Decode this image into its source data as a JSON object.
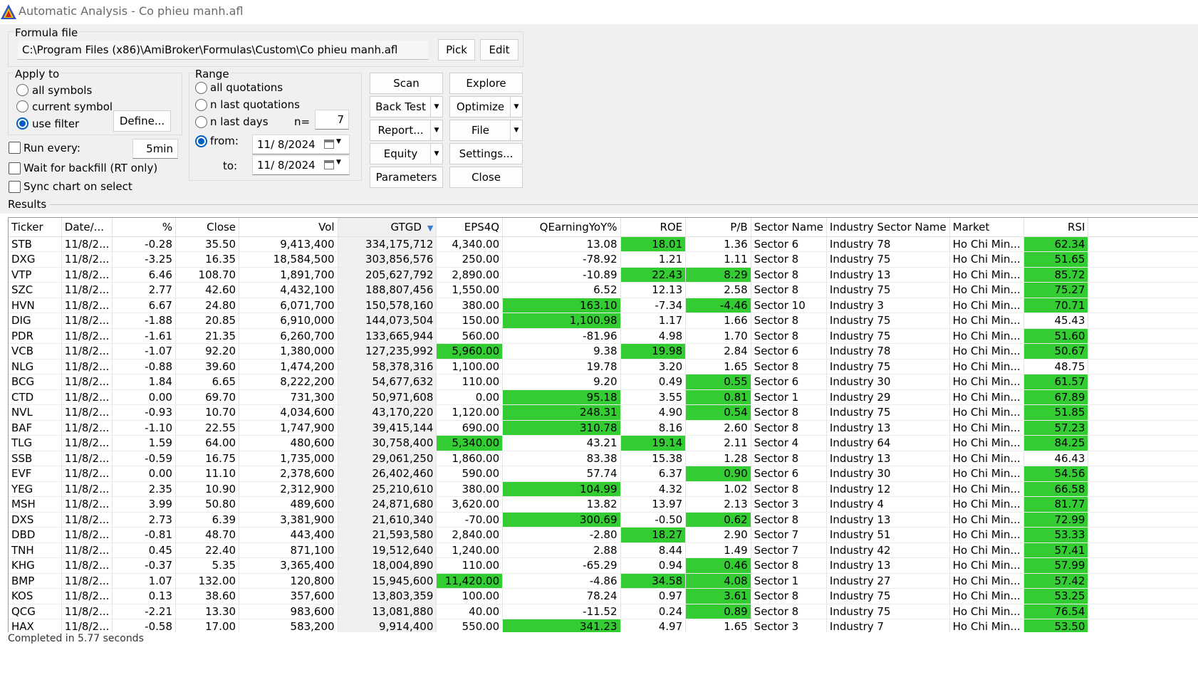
{
  "window": {
    "title": "Automatic Analysis - Co phieu manh.afl"
  },
  "formula": {
    "group_label": "Formula file",
    "path": "C:\\Program Files (x86)\\AmiBroker\\Formulas\\Custom\\Co phieu manh.afl",
    "pick_label": "Pick",
    "edit_label": "Edit"
  },
  "apply_to": {
    "group_label": "Apply to",
    "all_symbols": "all symbols",
    "current_symbol": "current symbol",
    "use_filter": "use filter",
    "selected": "use filter",
    "define_label": "Define..."
  },
  "range": {
    "group_label": "Range",
    "all_quotations": "all quotations",
    "n_last_quotations": "n last quotations",
    "n_last_days": "n last days",
    "n_label": "n=",
    "n_value": "7",
    "from_label": "from:",
    "from_value": "11/  8/2024",
    "to_label": "to:",
    "to_value": "11/  8/2024",
    "selected": "from"
  },
  "options": {
    "run_every_label": "Run every:",
    "run_every_value": "5min",
    "wait_backfill": "Wait for backfill (RT only)",
    "sync_chart": "Sync chart on select"
  },
  "buttons": {
    "scan": "Scan",
    "explore": "Explore",
    "back_test": "Back Test",
    "optimize": "Optimize",
    "report": "Report...",
    "file": "File",
    "equity": "Equity",
    "settings": "Settings...",
    "parameters": "Parameters",
    "close": "Close"
  },
  "results": {
    "label": "Results",
    "columns": [
      "Ticker",
      "Date/...",
      "%",
      "Close",
      "Vol",
      "GTGD",
      "EPS4Q",
      "QEarningYoY%",
      "ROE",
      "P/B",
      "Sector Name",
      "Industry Sector Name",
      "Market",
      "RSI"
    ],
    "rows": [
      [
        "STB",
        "11/8/2...",
        "-0.28",
        "35.50",
        "9,413,400",
        "334,175,712",
        "4,340.00",
        "13.08",
        "18.01",
        "1.36",
        "Sector 6",
        "Industry 78",
        "Ho Chi Min...",
        "62.34"
      ],
      [
        "DXG",
        "11/8/2...",
        "-3.25",
        "16.35",
        "18,584,500",
        "303,856,576",
        "250.00",
        "-78.92",
        "1.21",
        "1.11",
        "Sector 8",
        "Industry 75",
        "Ho Chi Min...",
        "51.65"
      ],
      [
        "VTP",
        "11/8/2...",
        "6.46",
        "108.70",
        "1,891,700",
        "205,627,792",
        "2,890.00",
        "-10.89",
        "22.43",
        "8.29",
        "Sector 8",
        "Industry 13",
        "Ho Chi Min...",
        "85.72"
      ],
      [
        "SZC",
        "11/8/2...",
        "2.77",
        "42.60",
        "4,432,100",
        "188,807,456",
        "1,550.00",
        "6.52",
        "12.13",
        "2.58",
        "Sector 8",
        "Industry 75",
        "Ho Chi Min...",
        "75.27"
      ],
      [
        "HVN",
        "11/8/2...",
        "6.67",
        "24.80",
        "6,071,700",
        "150,578,160",
        "380.00",
        "163.10",
        "-7.34",
        "-4.46",
        "Sector 10",
        "Industry 3",
        "Ho Chi Min...",
        "70.71"
      ],
      [
        "DIG",
        "11/8/2...",
        "-1.88",
        "20.85",
        "6,910,000",
        "144,073,504",
        "150.00",
        "1,100.98",
        "1.17",
        "1.66",
        "Sector 8",
        "Industry 75",
        "Ho Chi Min...",
        "45.43"
      ],
      [
        "PDR",
        "11/8/2...",
        "-1.61",
        "21.35",
        "6,260,700",
        "133,665,944",
        "560.00",
        "-81.96",
        "4.98",
        "1.70",
        "Sector 8",
        "Industry 75",
        "Ho Chi Min...",
        "51.60"
      ],
      [
        "VCB",
        "11/8/2...",
        "-1.07",
        "92.20",
        "1,380,000",
        "127,235,992",
        "5,960.00",
        "9.38",
        "19.98",
        "2.84",
        "Sector 6",
        "Industry 78",
        "Ho Chi Min...",
        "50.67"
      ],
      [
        "NLG",
        "11/8/2...",
        "-0.88",
        "39.60",
        "1,474,200",
        "58,378,316",
        "1,100.00",
        "19.78",
        "3.20",
        "1.65",
        "Sector 8",
        "Industry 75",
        "Ho Chi Min...",
        "48.75"
      ],
      [
        "BCG",
        "11/8/2...",
        "1.84",
        "6.65",
        "8,222,200",
        "54,677,632",
        "110.00",
        "9.20",
        "0.49",
        "0.55",
        "Sector 6",
        "Industry 30",
        "Ho Chi Min...",
        "61.57"
      ],
      [
        "CTD",
        "11/8/2...",
        "0.00",
        "69.70",
        "731,300",
        "50,971,608",
        "0.00",
        "95.18",
        "3.55",
        "0.81",
        "Sector 1",
        "Industry 29",
        "Ho Chi Min...",
        "67.89"
      ],
      [
        "NVL",
        "11/8/2...",
        "-0.93",
        "10.70",
        "4,034,600",
        "43,170,220",
        "1,120.00",
        "248.31",
        "4.90",
        "0.54",
        "Sector 8",
        "Industry 75",
        "Ho Chi Min...",
        "51.85"
      ],
      [
        "BAF",
        "11/8/2...",
        "-1.10",
        "22.55",
        "1,747,900",
        "39,415,144",
        "690.00",
        "310.78",
        "8.16",
        "2.60",
        "Sector 8",
        "Industry 13",
        "Ho Chi Min...",
        "57.23"
      ],
      [
        "TLG",
        "11/8/2...",
        "1.59",
        "64.00",
        "480,600",
        "30,758,400",
        "5,340.00",
        "43.21",
        "19.14",
        "2.11",
        "Sector 4",
        "Industry 64",
        "Ho Chi Min...",
        "84.25"
      ],
      [
        "SSB",
        "11/8/2...",
        "-0.59",
        "16.75",
        "1,735,000",
        "29,061,250",
        "1,860.00",
        "83.38",
        "15.38",
        "1.28",
        "Sector 8",
        "Industry 13",
        "Ho Chi Min...",
        "46.43"
      ],
      [
        "EVF",
        "11/8/2...",
        "0.00",
        "11.10",
        "2,378,600",
        "26,402,460",
        "590.00",
        "57.74",
        "6.37",
        "0.90",
        "Sector 6",
        "Industry 30",
        "Ho Chi Min...",
        "54.56"
      ],
      [
        "YEG",
        "11/8/2...",
        "2.35",
        "10.90",
        "2,312,900",
        "25,210,610",
        "380.00",
        "104.99",
        "4.32",
        "1.02",
        "Sector 8",
        "Industry 12",
        "Ho Chi Min...",
        "66.58"
      ],
      [
        "MSH",
        "11/8/2...",
        "3.99",
        "50.80",
        "489,600",
        "24,871,680",
        "3,620.00",
        "13.82",
        "13.97",
        "2.13",
        "Sector 3",
        "Industry 4",
        "Ho Chi Min...",
        "81.77"
      ],
      [
        "DXS",
        "11/8/2...",
        "2.73",
        "6.39",
        "3,381,900",
        "21,610,340",
        "-70.00",
        "300.69",
        "-0.50",
        "0.62",
        "Sector 8",
        "Industry 13",
        "Ho Chi Min...",
        "72.99"
      ],
      [
        "DBD",
        "11/8/2...",
        "-0.81",
        "48.70",
        "443,400",
        "21,593,580",
        "2,840.00",
        "-2.80",
        "18.27",
        "2.90",
        "Sector 7",
        "Industry 51",
        "Ho Chi Min...",
        "53.33"
      ],
      [
        "TNH",
        "11/8/2...",
        "0.45",
        "22.40",
        "871,100",
        "19,512,640",
        "1,240.00",
        "2.88",
        "8.44",
        "1.49",
        "Sector 7",
        "Industry 42",
        "Ho Chi Min...",
        "57.41"
      ],
      [
        "KHG",
        "11/8/2...",
        "-0.37",
        "5.35",
        "3,365,400",
        "18,004,890",
        "110.00",
        "-65.29",
        "0.94",
        "0.46",
        "Sector 8",
        "Industry 13",
        "Ho Chi Min...",
        "57.99"
      ],
      [
        "BMP",
        "11/8/2...",
        "1.07",
        "132.00",
        "120,800",
        "15,945,600",
        "11,420.00",
        "-4.86",
        "34.58",
        "4.08",
        "Sector 1",
        "Industry 27",
        "Ho Chi Min...",
        "57.42"
      ],
      [
        "KOS",
        "11/8/2...",
        "0.13",
        "38.60",
        "357,600",
        "13,803,359",
        "100.00",
        "78.24",
        "0.97",
        "3.61",
        "Sector 8",
        "Industry 75",
        "Ho Chi Min...",
        "53.25"
      ],
      [
        "QCG",
        "11/8/2...",
        "-2.21",
        "13.30",
        "983,600",
        "13,081,880",
        "40.00",
        "-11.52",
        "0.24",
        "0.89",
        "Sector 8",
        "Industry 75",
        "Ho Chi Min...",
        "76.54"
      ],
      [
        "HAX",
        "11/8/2...",
        "-0.58",
        "17.00",
        "583,200",
        "9,914,400",
        "550.00",
        "341.23",
        "4.97",
        "1.65",
        "Sector 3",
        "Industry 7",
        "Ho Chi Min...",
        "53.50"
      ]
    ],
    "highlights": [
      [
        8,
        13
      ],
      [
        13
      ],
      [
        8,
        9,
        13
      ],
      [
        13
      ],
      [
        7,
        9,
        13
      ],
      [
        7
      ],
      [
        13
      ],
      [
        6,
        8,
        13
      ],
      [],
      [
        9,
        13
      ],
      [
        7,
        9,
        13
      ],
      [
        7,
        9,
        13
      ],
      [
        7,
        13
      ],
      [
        6,
        8,
        13
      ],
      [],
      [
        9,
        13
      ],
      [
        7,
        13
      ],
      [
        13
      ],
      [
        7,
        9,
        13
      ],
      [
        8,
        13
      ],
      [
        13
      ],
      [
        9,
        13
      ],
      [
        6,
        8,
        9,
        13
      ],
      [
        9,
        13
      ],
      [
        9,
        13
      ],
      [
        7,
        13
      ]
    ],
    "highlight_color": "#33cc33",
    "sorted_column": "GTGD",
    "status_text": "Completed in 5.77 seconds"
  }
}
